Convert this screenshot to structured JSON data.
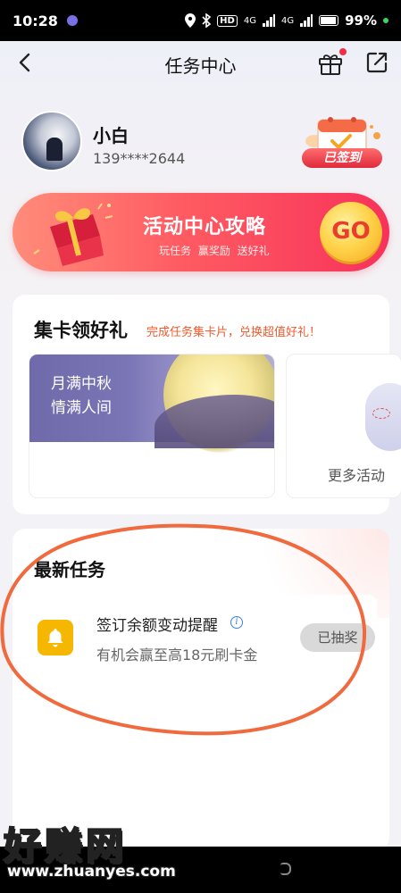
{
  "status_bar": {
    "time": "10:28",
    "network_1": "4G",
    "network_2": "4G",
    "hd": "HD",
    "battery": "99%"
  },
  "nav": {
    "title": "任务中心"
  },
  "user": {
    "name": "小白",
    "phone": "139****2644",
    "sign_status": "已签到"
  },
  "banner": {
    "title": "活动中心攻略",
    "subtitle": "玩任务 赢奖励 送好礼",
    "go_label": "GO"
  },
  "collect": {
    "title": "集卡领好礼",
    "subtitle": "完成任务集卡片，兑换超值好礼！",
    "card_text_line1": "月满中秋",
    "card_text_line2": "情满人间",
    "more_label": "更多活动"
  },
  "tasks": {
    "title": "最新任务",
    "items": [
      {
        "name": "签订余额变动提醒",
        "desc": "有机会赢至高18元刷卡金",
        "button": "已抽奖",
        "icon": "bell-icon"
      }
    ]
  },
  "watermark": {
    "text": "好赚网",
    "url": "www.zhuanyes.com"
  },
  "colors": {
    "accent_red": "#f7325a",
    "highlight_orange": "#ef5a2e",
    "annotation": "#f06a3e",
    "bell_yellow": "#f5b700"
  }
}
